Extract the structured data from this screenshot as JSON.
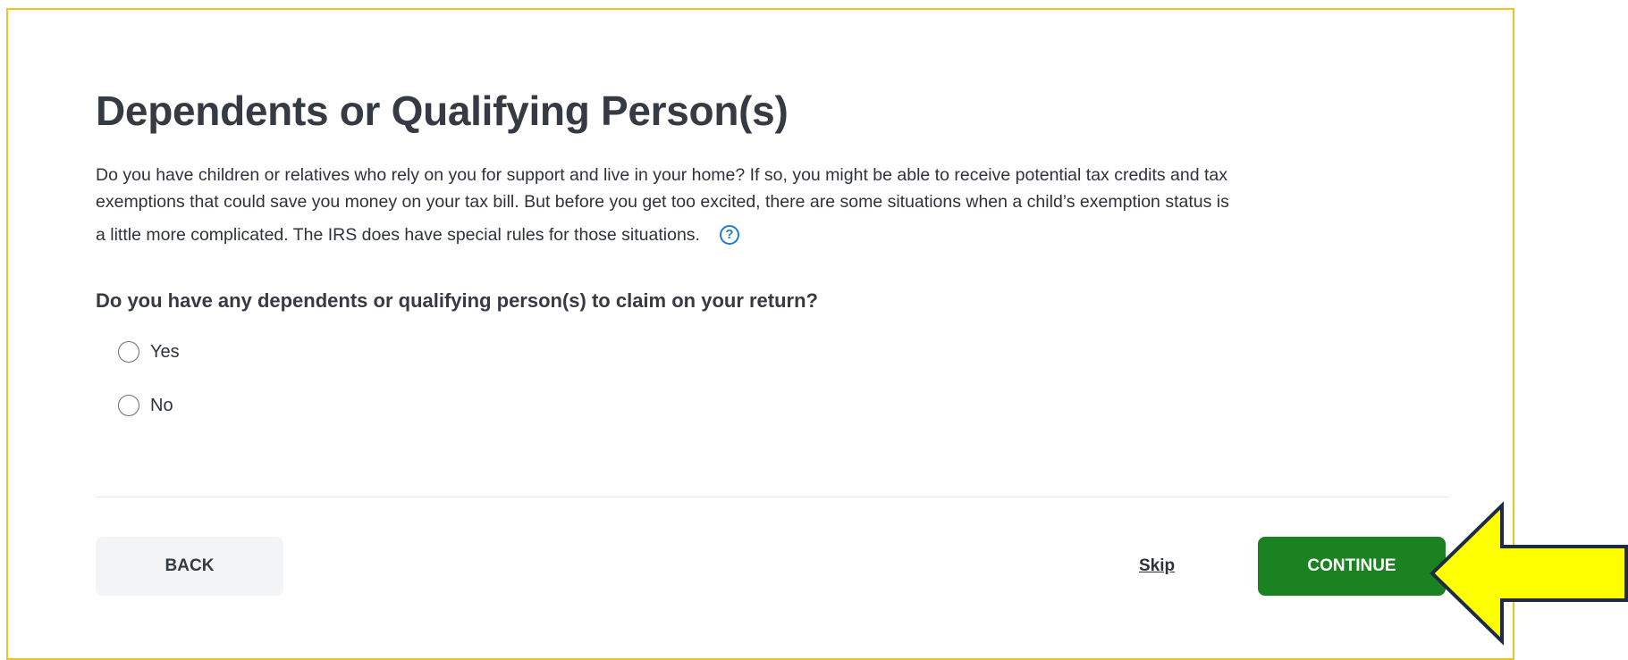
{
  "page": {
    "title": "Dependents or Qualifying Person(s)",
    "description_lines": [
      "Do you have children or relatives who rely on you for support and live in your home? If so, you might be able to receive potential tax credits and tax",
      "exemptions that could save you money on your tax bill. But before you get too excited, there are some situations when a child’s exemption status is",
      "a little more complicated. The IRS does have special rules for those situations."
    ],
    "help_icon": "?",
    "question": "Do you have any dependents or qualifying person(s) to claim on your return?",
    "options": [
      "Yes",
      "No"
    ]
  },
  "footer": {
    "back_label": "BACK",
    "skip_label": "Skip",
    "continue_label": "CONTINUE"
  },
  "colors": {
    "frame_border": "#f2c21a",
    "continue_bg": "#1a8221",
    "help_icon": "#1d7ad8",
    "arrow_fill": "#ffff00",
    "arrow_stroke": "#1f2a44"
  },
  "icons": {
    "help": "question-circle-icon",
    "annotation": "arrow-left-icon"
  }
}
